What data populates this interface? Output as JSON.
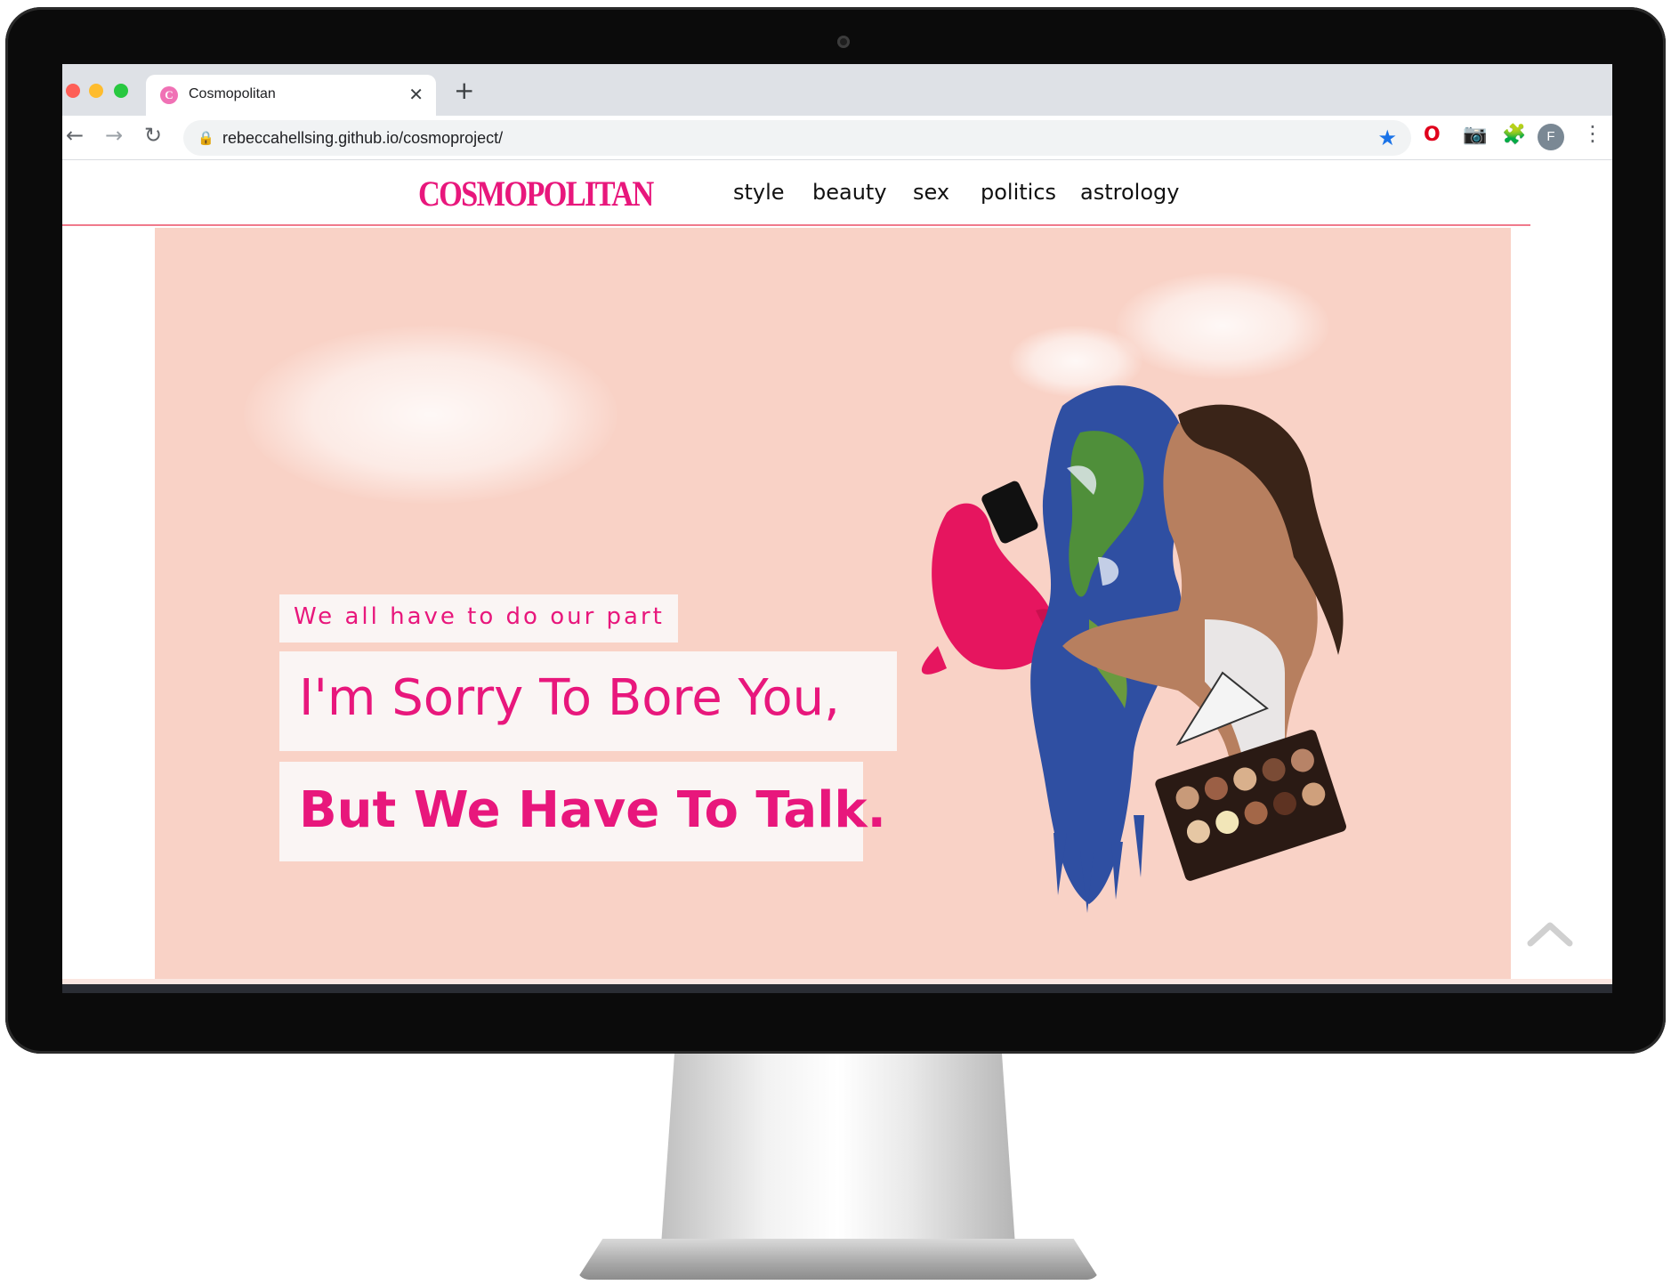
{
  "browser": {
    "tab": {
      "title": "Cosmopolitan",
      "favicon_letter": "C",
      "close_glyph": "✕"
    },
    "new_tab_glyph": "+",
    "nav": {
      "back_glyph": "←",
      "forward_glyph": "→",
      "reload_glyph": "↻"
    },
    "address": {
      "url": "rebeccahellsing.github.io/cosmoproject/",
      "lock_glyph": "🔒",
      "star_glyph": "★"
    },
    "extensions": {
      "opera_glyph": "O",
      "camera_glyph": "📷",
      "puzzle_glyph": "🧩"
    },
    "profile": {
      "initial": "F"
    },
    "menu_glyph": "⋮"
  },
  "site": {
    "logo": "COSMOPOLITAN",
    "nav": [
      "style",
      "beauty",
      "sex",
      "politics",
      "astrology"
    ],
    "accent_color": "#e8177c",
    "hero": {
      "background": "#f9d2c6",
      "kicker": "We all have to do our part",
      "headline_line1": "I'm Sorry To Bore You,",
      "headline_line2": "But We Have To Talk."
    }
  },
  "icons": {
    "scroll_to_top": "chevron-up-icon",
    "collage": "earth-woman-collage-illustration"
  }
}
